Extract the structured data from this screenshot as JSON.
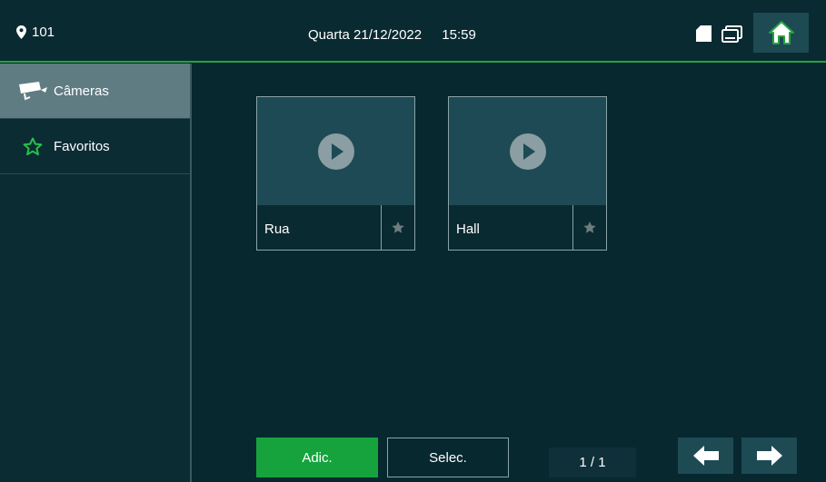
{
  "header": {
    "room": "101",
    "weekday": "Quarta",
    "date": "21/12/2022",
    "time": "15:59"
  },
  "sidebar": {
    "items": [
      {
        "label": "Câmeras",
        "icon": "camera-icon",
        "active": true
      },
      {
        "label": "Favoritos",
        "icon": "star-outline-icon",
        "active": false
      }
    ]
  },
  "cameras": [
    {
      "name": "Rua"
    },
    {
      "name": "Hall"
    }
  ],
  "footer": {
    "add_label": "Adic.",
    "select_label": "Selec.",
    "page_indicator": "1 / 1"
  },
  "colors": {
    "accent_green": "#16a33d",
    "background": "#07282f",
    "tile": "#1d4a55"
  }
}
